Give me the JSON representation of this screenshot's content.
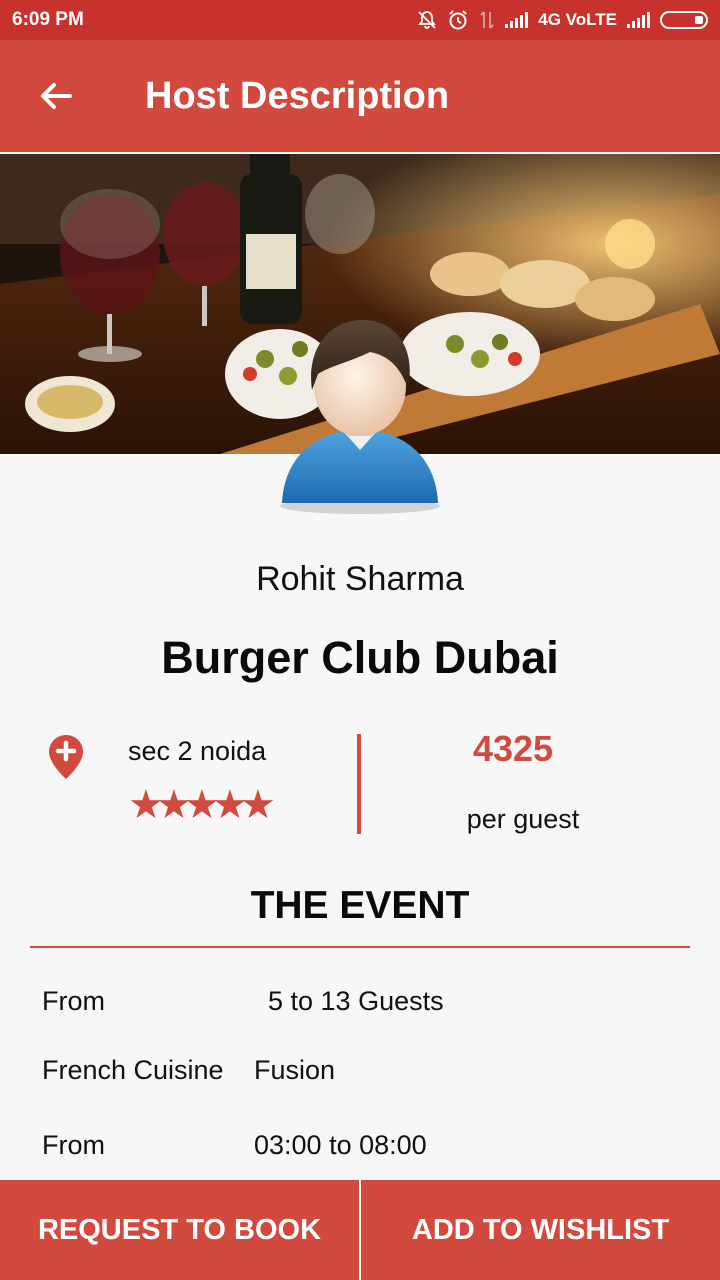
{
  "status_bar": {
    "time": "6:09 PM",
    "network": "4G VoLTE"
  },
  "toolbar": {
    "title": "Host Description",
    "back_icon": "arrow-back-icon"
  },
  "host": {
    "name": "Rohit Sharma",
    "venue": "Burger Club Dubai",
    "location": "sec 2 noida",
    "rating": 5,
    "price": "4325",
    "price_unit": "per guest"
  },
  "event": {
    "title": "THE EVENT",
    "rows": [
      {
        "label": "From",
        "value": "5 to 13 Guests"
      },
      {
        "label": "French Cuisine",
        "value": "Fusion"
      },
      {
        "label": "From",
        "value": "03:00 to 08:00"
      }
    ]
  },
  "actions": {
    "request": "REQUEST TO BOOK",
    "wishlist": "ADD TO WISHLIST"
  },
  "colors": {
    "status_bar": "#c8322c",
    "toolbar": "#d2493d",
    "accent": "#d2493d",
    "background": "#f7f7f7"
  }
}
